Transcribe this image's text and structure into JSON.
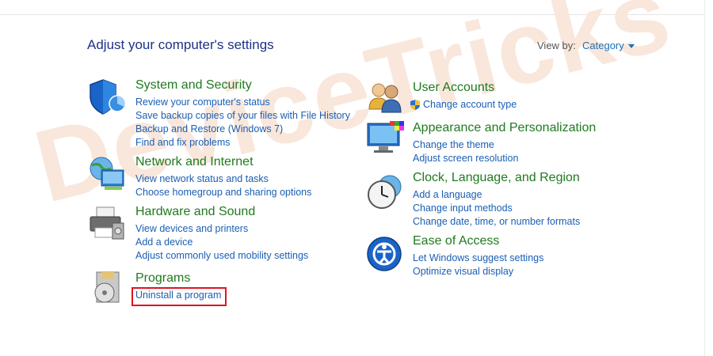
{
  "header": {
    "title": "Adjust your computer's settings",
    "view_by_label": "View by:",
    "view_by_value": "Category"
  },
  "watermark": "DeviceTricks",
  "categories": [
    {
      "title": "System and Security",
      "links": [
        "Review your computer's status",
        "Save backup copies of your files with File History",
        "Backup and Restore (Windows 7)",
        "Find and fix problems"
      ]
    },
    {
      "title": "Network and Internet",
      "links": [
        "View network status and tasks",
        "Choose homegroup and sharing options"
      ]
    },
    {
      "title": "Hardware and Sound",
      "links": [
        "View devices and printers",
        "Add a device",
        "Adjust commonly used mobility settings"
      ]
    },
    {
      "title": "Programs",
      "links": [
        "Uninstall a program"
      ]
    },
    {
      "title": "User Accounts",
      "links": [
        "Change account type"
      ]
    },
    {
      "title": "Appearance and Personalization",
      "links": [
        "Change the theme",
        "Adjust screen resolution"
      ]
    },
    {
      "title": "Clock, Language, and Region",
      "links": [
        "Add a language",
        "Change input methods",
        "Change date, time, or number formats"
      ]
    },
    {
      "title": "Ease of Access",
      "links": [
        "Let Windows suggest settings",
        "Optimize visual display"
      ]
    }
  ],
  "icons": [
    "security-shield-icon",
    "network-globe-icon",
    "printer-icon",
    "programs-disc-icon",
    "users-icon",
    "monitor-palette-icon",
    "clock-globe-icon",
    "ease-of-access-icon"
  ],
  "colors": {
    "title_green": "#1f7a1f",
    "link_blue": "#1a5fb4",
    "heading_blue": "#1e3287",
    "highlight_red": "#e0141e"
  }
}
